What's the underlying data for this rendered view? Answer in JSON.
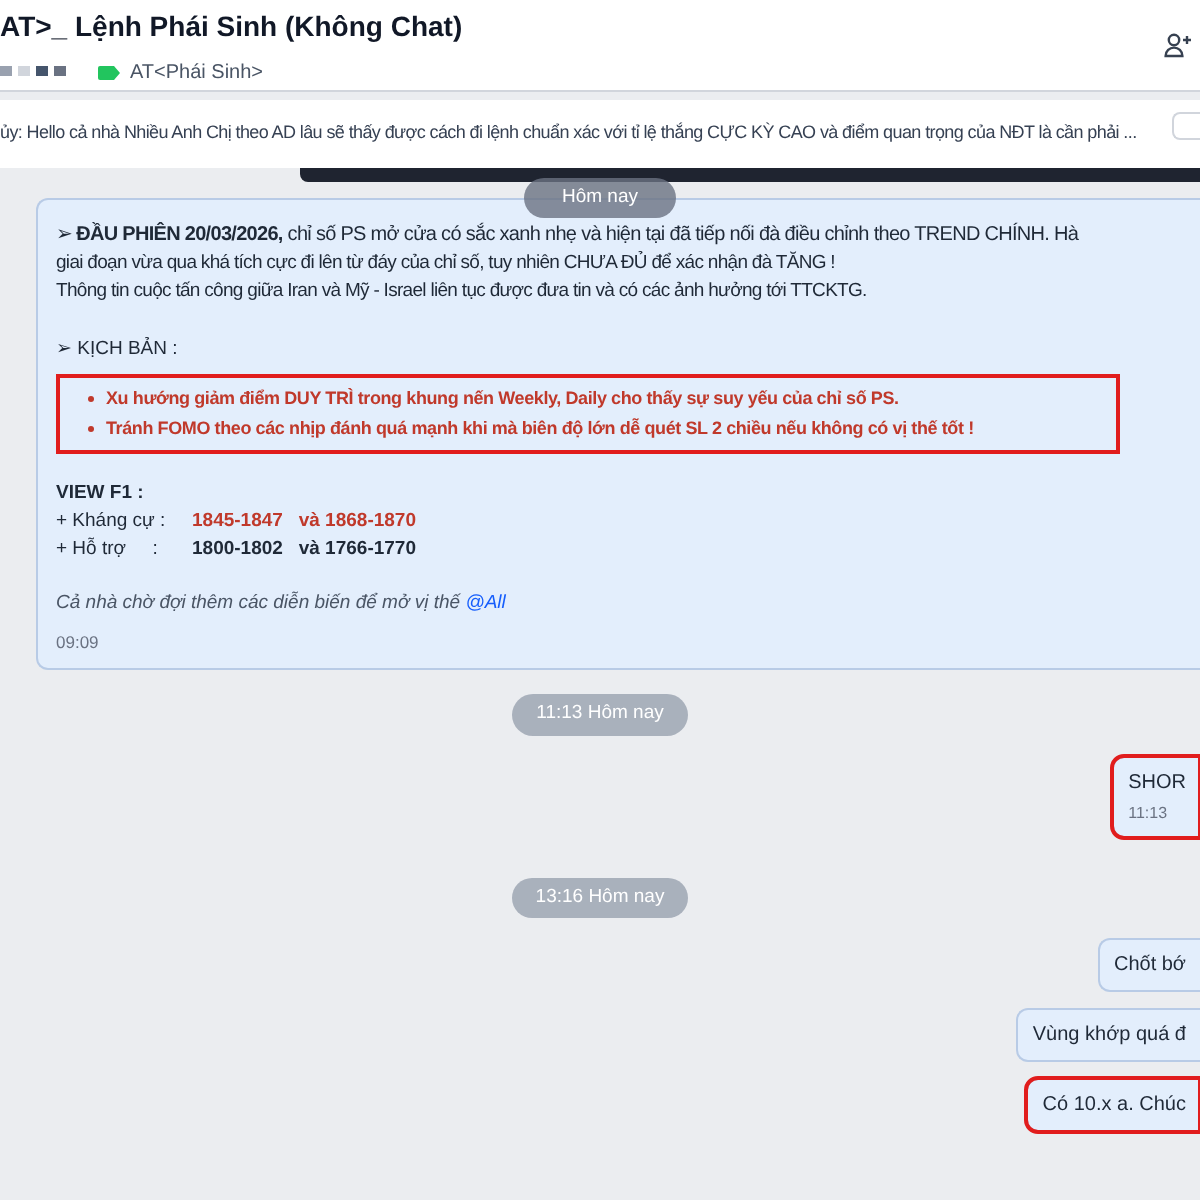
{
  "header": {
    "title": "AT>_ Lệnh Phái Sinh (Không Chat)",
    "tag": "AT<Phái Sinh>"
  },
  "pinned": {
    "text": "ủy: Hello cả nhà Nhiều Anh Chị theo AD lâu sẽ thấy được cách đi lệnh chuẩn xác với tỉ lệ thắng CỰC KỲ CAO và điểm quan trọng của NĐT là cần phải ..."
  },
  "messages": [
    {
      "kind": "date",
      "text": "Hôm nay"
    },
    {
      "kind": "post",
      "lines": [
        "➢ **ĐẦU PHIÊN 20/03/2026,** chỉ số PS mở cửa có sắc xanh nhẹ và hiện tại đã tiếp nối đà điều chỉnh theo TREND CHÍNH. Hà",
        "giai đoạn vừa qua khá tích cực đi lên từ đáy của chỉ số, tuy nhiên CHƯA ĐỦ để xác nhận đà TĂNG !",
        "Thông tin cuộc tấn công giữa Iran và Mỹ - Israel liên tục được đưa tin và có các ảnh hưởng tới TTCKTG."
      ],
      "section_title": "➢ KỊCH BẢN :",
      "highlighted": true,
      "bullets": [
        "Xu hướng giảm điểm DUY TRÌ trong khung nến Weekly, Daily cho thấy sự suy yếu của chỉ số PS.",
        "Tránh FOMO theo các nhịp đánh quá mạnh khi mà biên độ lớn dễ quét SL 2 chiều nếu không có vị thế tốt !"
      ],
      "view_title": "VIEW F1 :",
      "levels": [
        {
          "label": "+ Kháng cự :",
          "values": "1845-1847   và 1868-1870",
          "color": "#c0392b"
        },
        {
          "label": "+ Hỗ trợ     :",
          "values": "1800-1802   và 1766-1770",
          "color": "#1f2937"
        }
      ],
      "closing": "Cả nhà chờ đợi thêm các diễn biến để mở vị thế",
      "mention": "@All",
      "time": "09:09"
    },
    {
      "kind": "date",
      "text": "11:13 Hôm nay"
    },
    {
      "kind": "mine",
      "text": "SHOR",
      "time": "11:13",
      "highlighted": true
    },
    {
      "kind": "date",
      "text": "13:16 Hôm nay"
    },
    {
      "kind": "mine",
      "text": "Chốt bớ",
      "highlighted": false
    },
    {
      "kind": "mine",
      "text": "Vùng khớp quá đ",
      "highlighted": false
    },
    {
      "kind": "mine",
      "text": "Có 10.x a. Chúc",
      "highlighted": true
    }
  ]
}
